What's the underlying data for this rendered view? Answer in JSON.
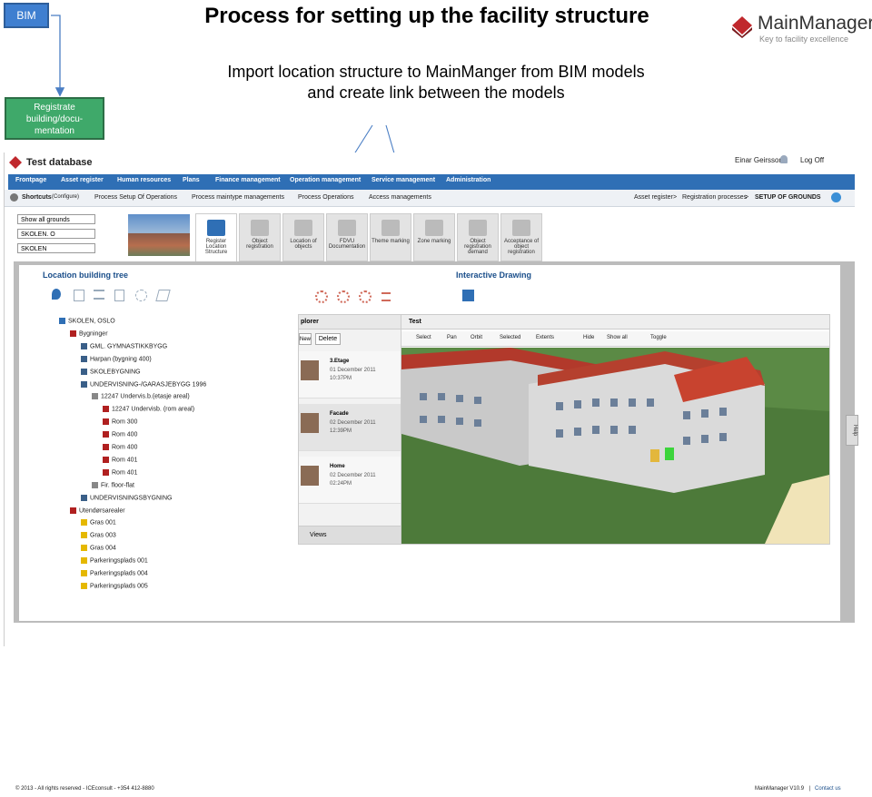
{
  "slide": {
    "title": "Process for setting up the facility structure",
    "subtitle_line1": "Import location structure to MainManger from BIM models",
    "subtitle_line2": "and create link between the models",
    "bim_box": "BIM",
    "registrate_box_l1": "Registrate",
    "registrate_box_l2": "building/docu-",
    "registrate_box_l3": "mentation"
  },
  "logo": {
    "name": "MainManager",
    "tagline": "Key to facility excellence",
    "color": "#c0282d"
  },
  "app": {
    "title": "Test database",
    "user": "Einar Geirsson",
    "logoff": "Log Off",
    "nav": [
      "Frontpage",
      "Asset register",
      "Human resources",
      "Plans",
      "Finance management",
      "Operation management",
      "Service management",
      "Administration"
    ],
    "shortcuts_label": "Shortcuts",
    "shortcuts_configure": "(Configure)",
    "shortcuts": [
      "Process  Setup Of Operations",
      "Process maintype managements",
      "Process Operations",
      "Access managements"
    ],
    "breadcrumb": [
      "Asset register",
      ">",
      "Registration processes",
      ">",
      "SETUP OF GROUNDS"
    ],
    "selects": [
      "Show all grounds",
      "SKOLEN. O",
      "SKOLEN"
    ],
    "tabs": [
      {
        "l1": "Register",
        "l2": "Location",
        "l3": "Structure"
      },
      {
        "l1": "Object",
        "l2": "registration",
        "l3": ""
      },
      {
        "l1": "Location of",
        "l2": "objects",
        "l3": ""
      },
      {
        "l1": "FDVU",
        "l2": "Documentation",
        "l3": ""
      },
      {
        "l1": "Theme marking",
        "l2": "",
        "l3": ""
      },
      {
        "l1": "Zone marking",
        "l2": "",
        "l3": ""
      },
      {
        "l1": "Object",
        "l2": "registration",
        "l3": "demand"
      },
      {
        "l1": "Acceptance of",
        "l2": "object",
        "l3": "registration"
      }
    ],
    "tree_title": "Location building tree",
    "drawing_title": "Interactive Drawing",
    "help_label": "Help",
    "tree": [
      {
        "label": "SKOLEN, OSLO",
        "level": 0,
        "type": "site"
      },
      {
        "label": "Bygninger",
        "level": 1,
        "type": "folder"
      },
      {
        "label": "GML. GYMNASTIKKBYGG",
        "level": 2,
        "type": "building"
      },
      {
        "label": "Harpan (bygning 400)",
        "level": 2,
        "type": "building"
      },
      {
        "label": "SKOLEBYGNING",
        "level": 2,
        "type": "building"
      },
      {
        "label": "UNDERVISNING-/GARASJEBYGG 1996",
        "level": 2,
        "type": "building"
      },
      {
        "label": "12247 Undervis.b.(etasje areal)",
        "level": 3,
        "type": "floor"
      },
      {
        "label": "12247 Undervisb. (rom areal)",
        "level": 4,
        "type": "room"
      },
      {
        "label": "Rom 300",
        "level": 4,
        "type": "room"
      },
      {
        "label": "Rom 400",
        "level": 4,
        "type": "room"
      },
      {
        "label": "Rom 400",
        "level": 4,
        "type": "room"
      },
      {
        "label": "Rom 401",
        "level": 4,
        "type": "room"
      },
      {
        "label": "Rom 401",
        "level": 4,
        "type": "room"
      },
      {
        "label": "Fir. floor-flat",
        "level": 3,
        "type": "floor"
      },
      {
        "label": "UNDERVISNINGSBYGNING",
        "level": 2,
        "type": "building"
      },
      {
        "label": "Utendørsarealer",
        "level": 1,
        "type": "folder"
      },
      {
        "label": "Gras 001",
        "level": 2,
        "type": "outdoor"
      },
      {
        "label": "Gras 003",
        "level": 2,
        "type": "outdoor"
      },
      {
        "label": "Gras 004",
        "level": 2,
        "type": "outdoor"
      },
      {
        "label": "Parkeringsplads 001",
        "level": 2,
        "type": "outdoor"
      },
      {
        "label": "Parkeringsplads 004",
        "level": 2,
        "type": "outdoor"
      },
      {
        "label": "Parkeringsplads 005",
        "level": 2,
        "type": "outdoor"
      }
    ],
    "explorer": {
      "title": "plorer",
      "btn_new": "New",
      "btn_delete": "Delete",
      "views_label": "Views",
      "items": [
        {
          "name": "3.Etage",
          "date": "01 December 2011",
          "time": "10:37PM"
        },
        {
          "name": "Facade",
          "date": "02 December 2011",
          "time": "12:39PM"
        },
        {
          "name": "Home",
          "date": "02 December 2011",
          "time": "02:24PM"
        }
      ]
    },
    "viewer": {
      "title": "Test",
      "tools": [
        "Select",
        "Pan",
        "Orbit",
        "Selected",
        "Extents",
        "Hide",
        "Show all",
        "Toggle"
      ]
    },
    "footer_left": "© 2013 - All rights reserved - ICEconsult - +354 412-8880",
    "footer_version": "MainManager V10.9",
    "footer_contact": "Contact us"
  }
}
